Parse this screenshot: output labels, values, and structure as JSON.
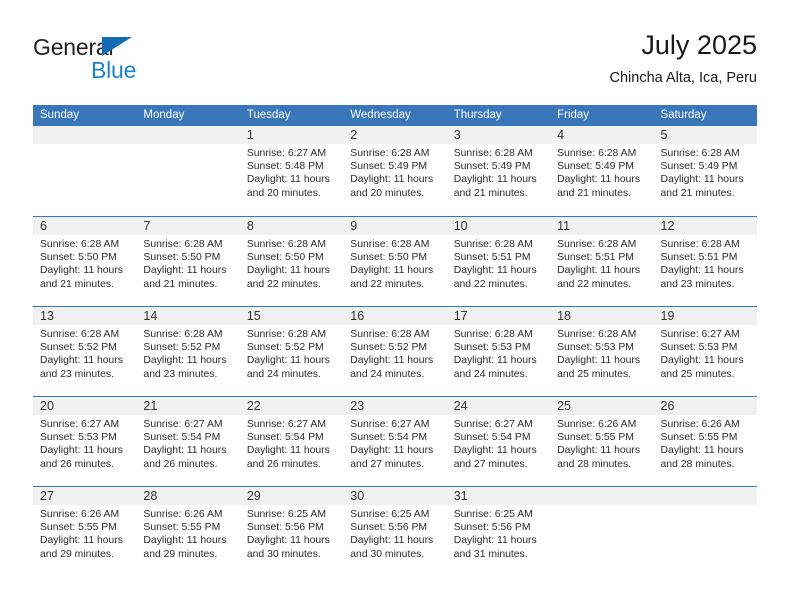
{
  "brand": {
    "name_part1": "General",
    "name_part2": "Blue",
    "triangle_color": "#156bb1",
    "blue_color": "#1a84d0"
  },
  "header": {
    "title": "July 2025",
    "subtitle": "Chincha Alta, Ica, Peru"
  },
  "colors": {
    "header_blue": "#3a77ba",
    "day_band_gray": "#f1f1f1",
    "text": "#2b2b2b"
  },
  "weekdays": [
    "Sunday",
    "Monday",
    "Tuesday",
    "Wednesday",
    "Thursday",
    "Friday",
    "Saturday"
  ],
  "weeks": [
    [
      {
        "empty": true
      },
      {
        "empty": true
      },
      {
        "day": "1",
        "sunrise": "Sunrise: 6:27 AM",
        "sunset": "Sunset: 5:48 PM",
        "daylight1": "Daylight: 11 hours",
        "daylight2": "and 20 minutes."
      },
      {
        "day": "2",
        "sunrise": "Sunrise: 6:28 AM",
        "sunset": "Sunset: 5:49 PM",
        "daylight1": "Daylight: 11 hours",
        "daylight2": "and 20 minutes."
      },
      {
        "day": "3",
        "sunrise": "Sunrise: 6:28 AM",
        "sunset": "Sunset: 5:49 PM",
        "daylight1": "Daylight: 11 hours",
        "daylight2": "and 21 minutes."
      },
      {
        "day": "4",
        "sunrise": "Sunrise: 6:28 AM",
        "sunset": "Sunset: 5:49 PM",
        "daylight1": "Daylight: 11 hours",
        "daylight2": "and 21 minutes."
      },
      {
        "day": "5",
        "sunrise": "Sunrise: 6:28 AM",
        "sunset": "Sunset: 5:49 PM",
        "daylight1": "Daylight: 11 hours",
        "daylight2": "and 21 minutes."
      }
    ],
    [
      {
        "day": "6",
        "sunrise": "Sunrise: 6:28 AM",
        "sunset": "Sunset: 5:50 PM",
        "daylight1": "Daylight: 11 hours",
        "daylight2": "and 21 minutes."
      },
      {
        "day": "7",
        "sunrise": "Sunrise: 6:28 AM",
        "sunset": "Sunset: 5:50 PM",
        "daylight1": "Daylight: 11 hours",
        "daylight2": "and 21 minutes."
      },
      {
        "day": "8",
        "sunrise": "Sunrise: 6:28 AM",
        "sunset": "Sunset: 5:50 PM",
        "daylight1": "Daylight: 11 hours",
        "daylight2": "and 22 minutes."
      },
      {
        "day": "9",
        "sunrise": "Sunrise: 6:28 AM",
        "sunset": "Sunset: 5:50 PM",
        "daylight1": "Daylight: 11 hours",
        "daylight2": "and 22 minutes."
      },
      {
        "day": "10",
        "sunrise": "Sunrise: 6:28 AM",
        "sunset": "Sunset: 5:51 PM",
        "daylight1": "Daylight: 11 hours",
        "daylight2": "and 22 minutes."
      },
      {
        "day": "11",
        "sunrise": "Sunrise: 6:28 AM",
        "sunset": "Sunset: 5:51 PM",
        "daylight1": "Daylight: 11 hours",
        "daylight2": "and 22 minutes."
      },
      {
        "day": "12",
        "sunrise": "Sunrise: 6:28 AM",
        "sunset": "Sunset: 5:51 PM",
        "daylight1": "Daylight: 11 hours",
        "daylight2": "and 23 minutes."
      }
    ],
    [
      {
        "day": "13",
        "sunrise": "Sunrise: 6:28 AM",
        "sunset": "Sunset: 5:52 PM",
        "daylight1": "Daylight: 11 hours",
        "daylight2": "and 23 minutes."
      },
      {
        "day": "14",
        "sunrise": "Sunrise: 6:28 AM",
        "sunset": "Sunset: 5:52 PM",
        "daylight1": "Daylight: 11 hours",
        "daylight2": "and 23 minutes."
      },
      {
        "day": "15",
        "sunrise": "Sunrise: 6:28 AM",
        "sunset": "Sunset: 5:52 PM",
        "daylight1": "Daylight: 11 hours",
        "daylight2": "and 24 minutes."
      },
      {
        "day": "16",
        "sunrise": "Sunrise: 6:28 AM",
        "sunset": "Sunset: 5:52 PM",
        "daylight1": "Daylight: 11 hours",
        "daylight2": "and 24 minutes."
      },
      {
        "day": "17",
        "sunrise": "Sunrise: 6:28 AM",
        "sunset": "Sunset: 5:53 PM",
        "daylight1": "Daylight: 11 hours",
        "daylight2": "and 24 minutes."
      },
      {
        "day": "18",
        "sunrise": "Sunrise: 6:28 AM",
        "sunset": "Sunset: 5:53 PM",
        "daylight1": "Daylight: 11 hours",
        "daylight2": "and 25 minutes."
      },
      {
        "day": "19",
        "sunrise": "Sunrise: 6:27 AM",
        "sunset": "Sunset: 5:53 PM",
        "daylight1": "Daylight: 11 hours",
        "daylight2": "and 25 minutes."
      }
    ],
    [
      {
        "day": "20",
        "sunrise": "Sunrise: 6:27 AM",
        "sunset": "Sunset: 5:53 PM",
        "daylight1": "Daylight: 11 hours",
        "daylight2": "and 26 minutes."
      },
      {
        "day": "21",
        "sunrise": "Sunrise: 6:27 AM",
        "sunset": "Sunset: 5:54 PM",
        "daylight1": "Daylight: 11 hours",
        "daylight2": "and 26 minutes."
      },
      {
        "day": "22",
        "sunrise": "Sunrise: 6:27 AM",
        "sunset": "Sunset: 5:54 PM",
        "daylight1": "Daylight: 11 hours",
        "daylight2": "and 26 minutes."
      },
      {
        "day": "23",
        "sunrise": "Sunrise: 6:27 AM",
        "sunset": "Sunset: 5:54 PM",
        "daylight1": "Daylight: 11 hours",
        "daylight2": "and 27 minutes."
      },
      {
        "day": "24",
        "sunrise": "Sunrise: 6:27 AM",
        "sunset": "Sunset: 5:54 PM",
        "daylight1": "Daylight: 11 hours",
        "daylight2": "and 27 minutes."
      },
      {
        "day": "25",
        "sunrise": "Sunrise: 6:26 AM",
        "sunset": "Sunset: 5:55 PM",
        "daylight1": "Daylight: 11 hours",
        "daylight2": "and 28 minutes."
      },
      {
        "day": "26",
        "sunrise": "Sunrise: 6:26 AM",
        "sunset": "Sunset: 5:55 PM",
        "daylight1": "Daylight: 11 hours",
        "daylight2": "and 28 minutes."
      }
    ],
    [
      {
        "day": "27",
        "sunrise": "Sunrise: 6:26 AM",
        "sunset": "Sunset: 5:55 PM",
        "daylight1": "Daylight: 11 hours",
        "daylight2": "and 29 minutes."
      },
      {
        "day": "28",
        "sunrise": "Sunrise: 6:26 AM",
        "sunset": "Sunset: 5:55 PM",
        "daylight1": "Daylight: 11 hours",
        "daylight2": "and 29 minutes."
      },
      {
        "day": "29",
        "sunrise": "Sunrise: 6:25 AM",
        "sunset": "Sunset: 5:56 PM",
        "daylight1": "Daylight: 11 hours",
        "daylight2": "and 30 minutes."
      },
      {
        "day": "30",
        "sunrise": "Sunrise: 6:25 AM",
        "sunset": "Sunset: 5:56 PM",
        "daylight1": "Daylight: 11 hours",
        "daylight2": "and 30 minutes."
      },
      {
        "day": "31",
        "sunrise": "Sunrise: 6:25 AM",
        "sunset": "Sunset: 5:56 PM",
        "daylight1": "Daylight: 11 hours",
        "daylight2": "and 31 minutes."
      },
      {
        "empty": true
      },
      {
        "empty": true
      }
    ]
  ]
}
